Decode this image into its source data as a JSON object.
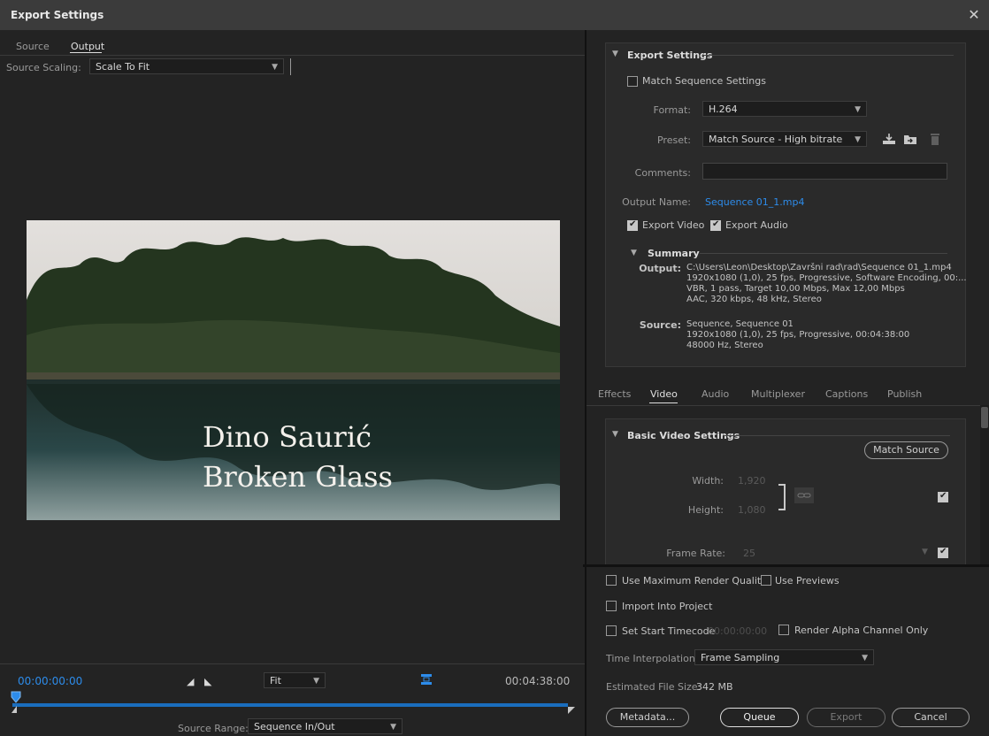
{
  "window": {
    "title": "Export Settings",
    "close": "✕"
  },
  "left": {
    "tabs": [
      "Source",
      "Output"
    ],
    "source_scaling_label": "Source Scaling:",
    "source_scaling_value": "Scale To Fit",
    "preview_text": [
      "Dino Saurić",
      "Broken Glass"
    ],
    "timecode_start": "00:00:00:00",
    "timecode_end": "00:04:38:00",
    "zoom_value": "Fit",
    "source_range_label": "Source Range:",
    "source_range_value": "Sequence In/Out"
  },
  "export_settings": {
    "heading": "Export Settings",
    "match_sequence": "Match Sequence Settings",
    "format_label": "Format:",
    "format_value": "H.264",
    "preset_label": "Preset:",
    "preset_value": "Match Source - High bitrate",
    "comments_label": "Comments:",
    "output_name_label": "Output Name:",
    "output_name_value": "Sequence 01_1.mp4",
    "export_video": "Export Video",
    "export_audio": "Export Audio",
    "summary_heading": "Summary",
    "summary_output_key": "Output:",
    "summary_output_val": "C:\\Users\\Leon\\Desktop\\Završni rad\\rad\\Sequence 01_1.mp4\n1920x1080 (1,0), 25 fps, Progressive, Software Encoding, 00:...\nVBR, 1 pass, Target 10,00 Mbps, Max 12,00 Mbps\nAAC, 320 kbps, 48 kHz, Stereo",
    "summary_source_key": "Source:",
    "summary_source_val": "Sequence, Sequence 01\n1920x1080 (1,0), 25 fps, Progressive, 00:04:38:00\n48000 Hz, Stereo"
  },
  "subtabs": [
    "Effects",
    "Video",
    "Audio",
    "Multiplexer",
    "Captions",
    "Publish"
  ],
  "basic_video": {
    "heading": "Basic Video Settings",
    "match_source": "Match Source",
    "width_label": "Width:",
    "width_value": "1,920",
    "height_label": "Height:",
    "height_value": "1,080",
    "frame_rate_label": "Frame Rate:",
    "frame_rate_value": "25"
  },
  "bottom": {
    "max_render_quality": "Use Maximum Render Quality",
    "use_previews": "Use Previews",
    "import_into_project": "Import Into Project",
    "set_start_timecode": "Set Start Timecode",
    "start_timecode_value": "00:00:00:00",
    "render_alpha": "Render Alpha Channel Only",
    "time_interp_label": "Time Interpolation:",
    "time_interp_value": "Frame Sampling",
    "est_size_label": "Estimated File Size:",
    "est_size_value": "342 MB",
    "metadata": "Metadata...",
    "queue": "Queue",
    "export": "Export",
    "cancel": "Cancel"
  },
  "colors": {
    "accent": "#2d8ceb",
    "timeline": "#1a6dbd",
    "background": "#232323"
  }
}
